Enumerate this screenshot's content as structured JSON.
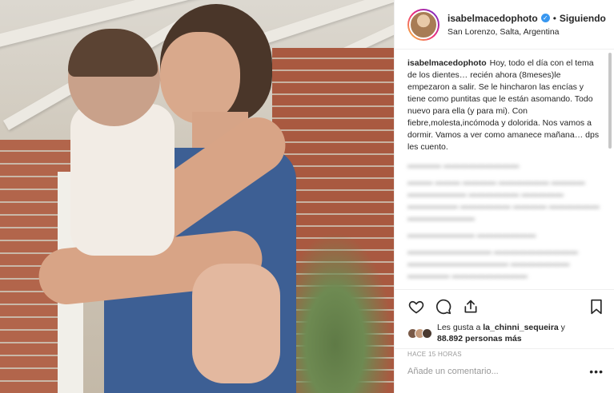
{
  "post": {
    "username": "isabelmacedophoto",
    "follow_status": "Siguiendo",
    "location": "San Lorenzo, Salta, Argentina",
    "verified_icon": "verified-badge-icon",
    "caption": "Hoy, todo el día con el tema de los dientes… recién ahora (8meses)le empezaron a salir. Se le hincharon las encías y tiene como puntitas que le están asomando. Todo nuevo para ella (y para mi). Con fiebre,molesta,incómoda y dolorida. Nos vamos a dormir. Vamos a ver como amanece mañana… dps les cuento.",
    "likes_text_1": "Les gusta a ",
    "likes_user": "la_chinni_sequeira",
    "likes_text_2": " y",
    "likes_count": "88.892 personas más",
    "time_ago": "HACE 15 HORAS",
    "comment_placeholder": "Añade un comentario...",
    "more_label": "•••"
  },
  "icons": {
    "like": "heart-icon",
    "comment": "comment-icon",
    "share": "share-icon",
    "save": "bookmark-icon"
  },
  "colors": {
    "accent": "#3897f0",
    "text": "#262626",
    "muted": "#999999"
  }
}
